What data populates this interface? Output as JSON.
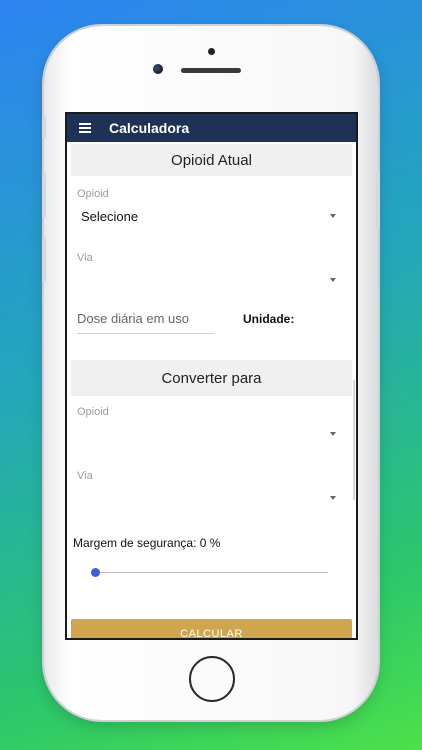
{
  "app": {
    "title": "Calculadora"
  },
  "current": {
    "header": "Opioid Atual",
    "opioid": {
      "label": "Opioid",
      "value": "Selecione"
    },
    "route": {
      "label": "Via",
      "value": ""
    },
    "dose": {
      "placeholder": "Dose diária em uso",
      "unit_label": "Unidade:"
    }
  },
  "convert": {
    "header": "Converter para",
    "opioid": {
      "label": "Opioid",
      "value": ""
    },
    "route": {
      "label": "Via",
      "value": ""
    },
    "safety_margin": {
      "label": "Margem de segurança: 0 %",
      "value_percent": 0
    }
  },
  "actions": {
    "calculate": "CALCULAR"
  },
  "colors": {
    "appbar": "#1e3258",
    "button": "#cfa64e",
    "slider_thumb": "#3b5bdb"
  },
  "icons": {
    "menu": "hamburger-menu-icon",
    "dropdown": "chevron-down-icon"
  }
}
